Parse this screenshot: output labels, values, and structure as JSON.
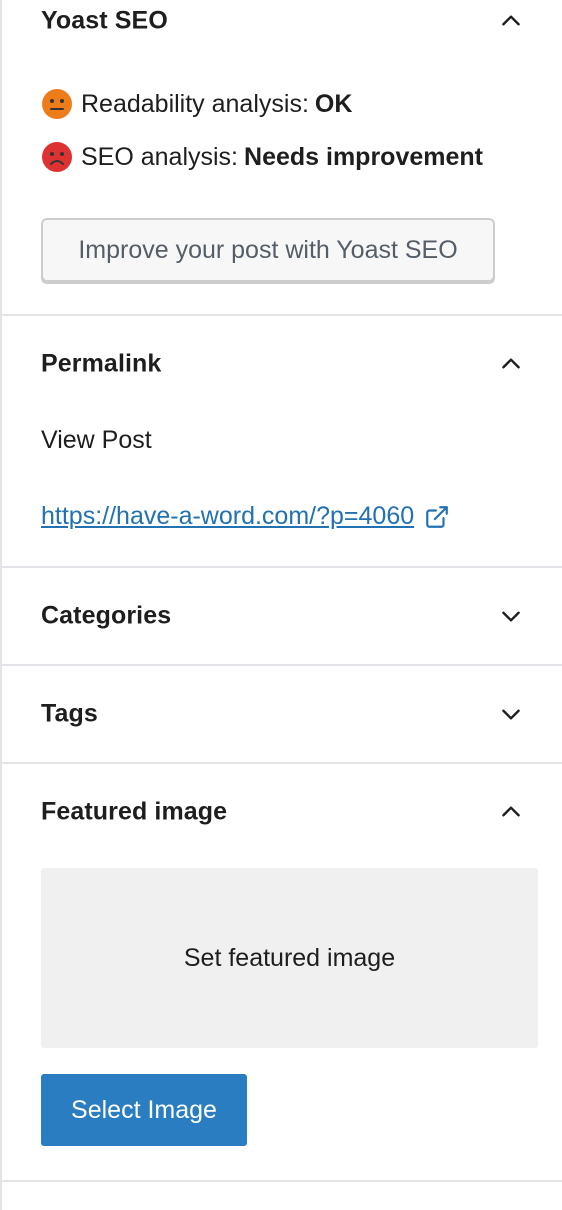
{
  "yoast": {
    "title": "Yoast SEO",
    "readability_label": "Readability analysis:",
    "readability_status": "OK",
    "seo_label": "SEO analysis:",
    "seo_status": "Needs improvement",
    "improve_button": "Improve your post with Yoast SEO",
    "colors": {
      "ok": "#ee7c1b",
      "bad": "#dc3232"
    }
  },
  "permalink": {
    "title": "Permalink",
    "view_label": "View Post",
    "url": "https://have-a-word.com/?p=4060"
  },
  "categories": {
    "title": "Categories"
  },
  "tags": {
    "title": "Tags"
  },
  "featured": {
    "title": "Featured image",
    "set_label": "Set featured image",
    "select_button": "Select Image"
  },
  "colors": {
    "link": "#2271b1",
    "primary_button": "#2a7dc1",
    "divider": "#e2e4e7"
  },
  "icons": {
    "expanded": "chevron-up-icon",
    "collapsed": "chevron-down-icon",
    "external": "external-link-icon",
    "ok_face": "neutral-face-icon",
    "bad_face": "sad-face-icon"
  }
}
